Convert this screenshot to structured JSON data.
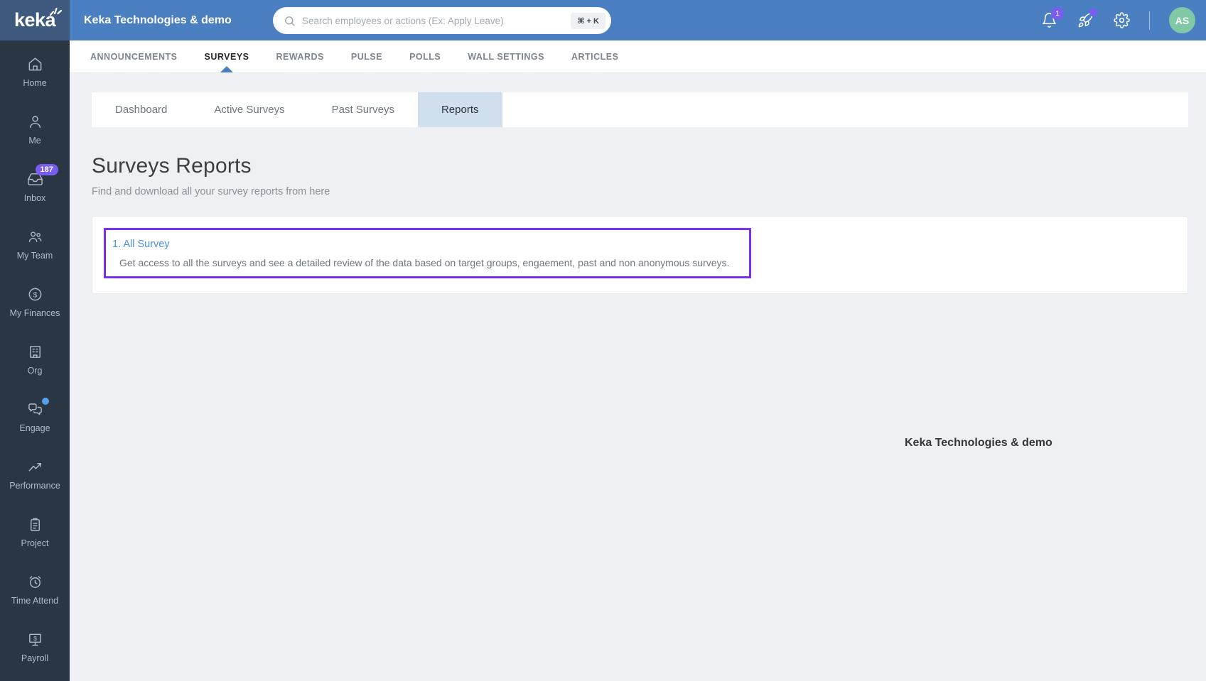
{
  "header": {
    "logo": "keka",
    "company": "Keka Technologies & demo",
    "search": {
      "placeholder": "Search employees or actions (Ex: Apply Leave)",
      "shortcut": "⌘ + K"
    },
    "notification_count": "1",
    "avatar_initials": "AS",
    "icons": [
      "bell-icon",
      "rocket-icon",
      "gear-icon"
    ]
  },
  "sidebar": {
    "items": [
      {
        "label": "Home",
        "icon": "home-icon"
      },
      {
        "label": "Me",
        "icon": "user-icon"
      },
      {
        "label": "Inbox",
        "icon": "inbox-icon",
        "badge": "187"
      },
      {
        "label": "My Team",
        "icon": "team-icon"
      },
      {
        "label": "My Finances",
        "icon": "dollar-circle-icon"
      },
      {
        "label": "Org",
        "icon": "building-icon"
      },
      {
        "label": "Engage",
        "icon": "chat-bubbles-icon",
        "dot": true
      },
      {
        "label": "Performance",
        "icon": "trend-up-icon"
      },
      {
        "label": "Project",
        "icon": "clipboard-icon"
      },
      {
        "label": "Time Attend",
        "icon": "alarm-clock-icon"
      },
      {
        "label": "Payroll",
        "icon": "monitor-dollar-icon"
      }
    ]
  },
  "nav": {
    "items": [
      "ANNOUNCEMENTS",
      "SURVEYS",
      "REWARDS",
      "PULSE",
      "POLLS",
      "WALL SETTINGS",
      "ARTICLES"
    ],
    "active": "SURVEYS"
  },
  "tabs": {
    "items": [
      "Dashboard",
      "Active Surveys",
      "Past Surveys",
      "Reports"
    ],
    "active": "Reports"
  },
  "page": {
    "title": "Surveys Reports",
    "subtitle": "Find and download all your survey reports from here"
  },
  "report_card": {
    "link": "1. All Survey",
    "description": "Get access to all the surveys and see a detailed review of the data based on target groups, engaement, past and non anonymous surveys."
  },
  "watermark": "Keka Technologies & demo",
  "colors": {
    "header_blue": "#4a80c2",
    "logo_navy": "#3e5a7f",
    "sidebar_navy": "#2b3645",
    "badge_purple": "#7a5cf0",
    "highlight_purple": "#7a2ff0",
    "avatar_green": "#80c9a7",
    "active_tab_bg": "#cfdfee",
    "link_blue": "#4a90d9",
    "engage_dot_blue": "#54a0e8"
  }
}
